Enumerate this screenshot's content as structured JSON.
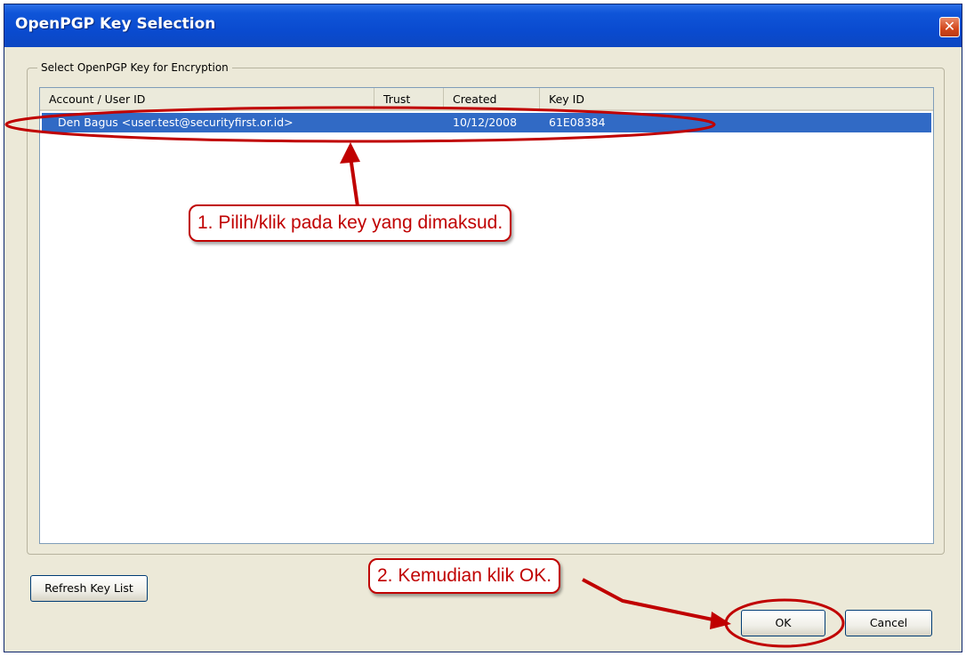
{
  "window": {
    "title": "OpenPGP Key Selection",
    "close_label": "✕"
  },
  "group": {
    "label": "Select OpenPGP Key for Encryption"
  },
  "table": {
    "columns": [
      "Account / User ID",
      "Trust",
      "Created",
      "Key ID"
    ],
    "rows": [
      {
        "account": "Den Bagus <user.test@securityfirst.or.id>",
        "trust": "",
        "created": "10/12/2008",
        "key_id": "61E08384"
      }
    ]
  },
  "buttons": {
    "refresh": "Refresh Key List",
    "ok": "OK",
    "cancel": "Cancel"
  },
  "annotations": {
    "step1": "1. Pilih/klik pada key yang dimaksud.",
    "step2": "2. Kemudian klik OK."
  },
  "colors": {
    "selection": "#316AC5",
    "annotation": "#C00000",
    "titlebar": "#0A4BD0"
  }
}
